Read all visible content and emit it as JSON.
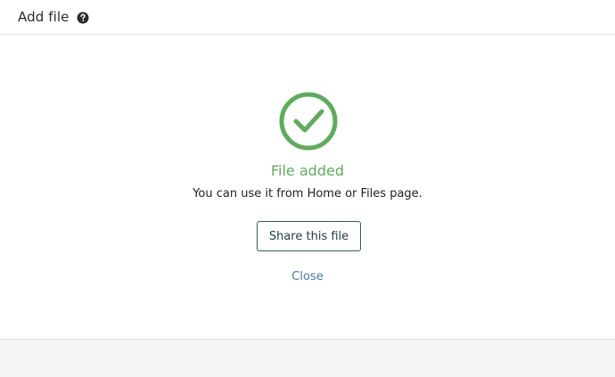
{
  "header": {
    "title": "Add file",
    "help_icon": "question-circle-icon"
  },
  "body": {
    "status_icon": "check-circle-icon",
    "status_title": "File added",
    "status_message": "You can use it from Home or Files page.",
    "share_button_label": "Share this file",
    "close_label": "Close"
  },
  "colors": {
    "success": "#5cad5a",
    "link": "#4a76a8",
    "button_border": "#2f5d6b",
    "footer_bg": "#f5f5f6"
  }
}
